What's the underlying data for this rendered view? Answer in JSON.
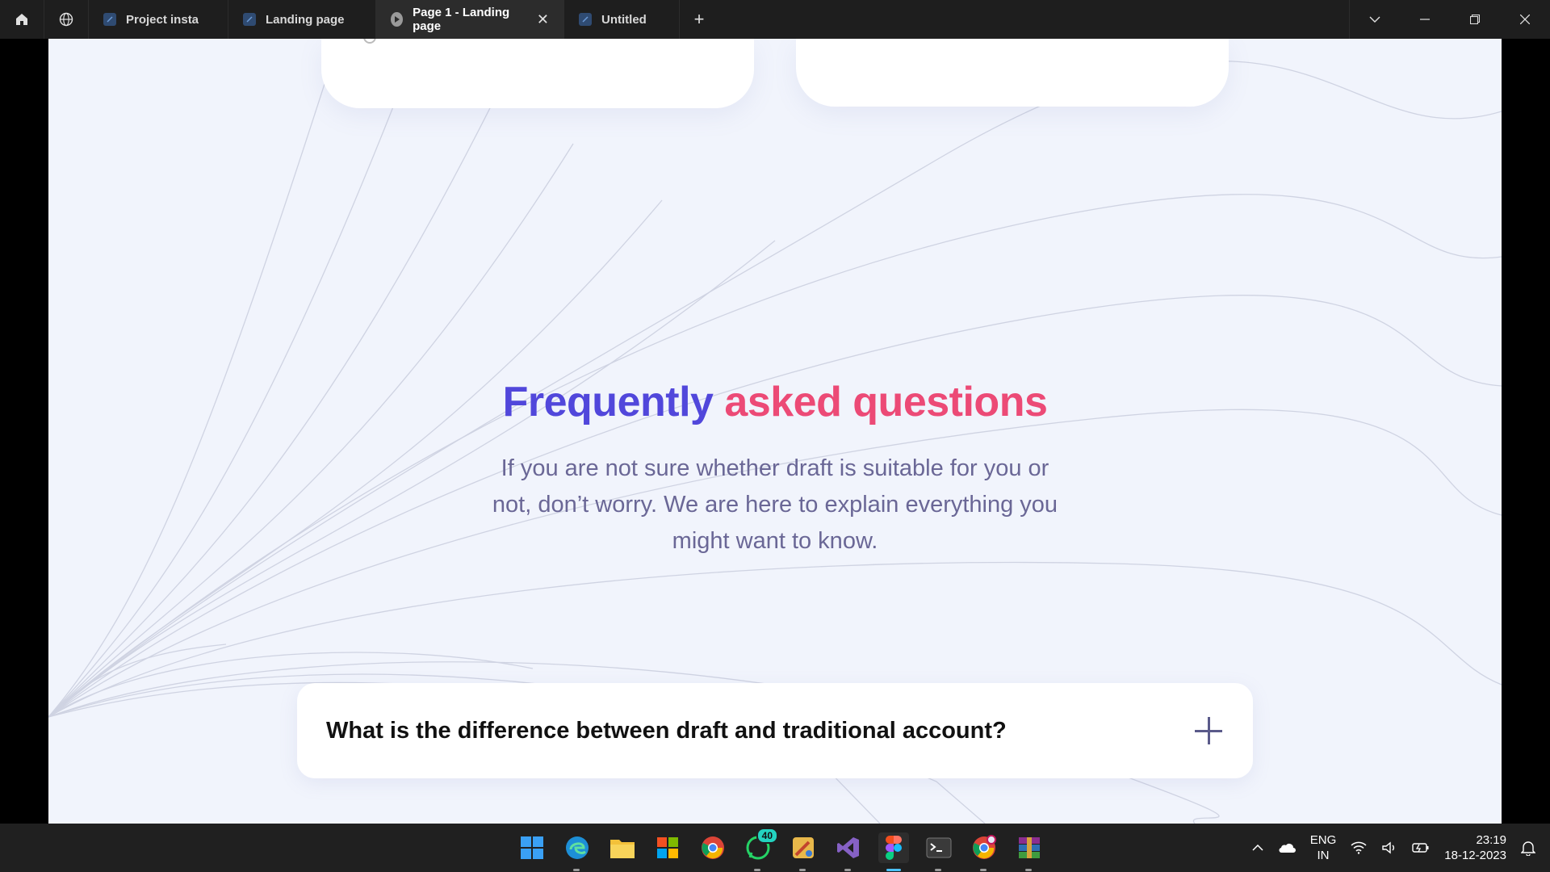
{
  "titlebar": {
    "tabs": [
      {
        "label": "Project insta",
        "active": false
      },
      {
        "label": "Landing page",
        "active": false
      },
      {
        "label": "Page 1 - Landing page",
        "active": true
      },
      {
        "label": "Untitled",
        "active": false
      }
    ],
    "add_tab": "+",
    "close_tab": "✕"
  },
  "canvas": {
    "faq": {
      "title_part1": "Frequently",
      "title_part2": "asked questions",
      "subtitle": "If you are not sure whether draft is suitable for you or not, don’t worry. We are here to explain everything you might want to know.",
      "items": [
        {
          "question": "What is the difference between draft and traditional account?"
        }
      ]
    },
    "colors": {
      "background": "#f1f4fc",
      "title_primary": "#5147db",
      "title_accent": "#ec4a76",
      "subtitle": "#6a6796"
    }
  },
  "taskbar": {
    "apps": [
      "windows-start-icon",
      "edge-icon",
      "file-explorer-icon",
      "microsoft-store-icon",
      "chrome-icon",
      "whatsapp-icon",
      "paint-icon",
      "visual-studio-icon",
      "figma-icon",
      "terminal-icon",
      "chrome-profile-icon",
      "winrar-icon"
    ],
    "whatsapp_badge": "40",
    "lang_line1": "ENG",
    "lang_line2": "IN",
    "time": "23:19",
    "date": "18-12-2023"
  }
}
